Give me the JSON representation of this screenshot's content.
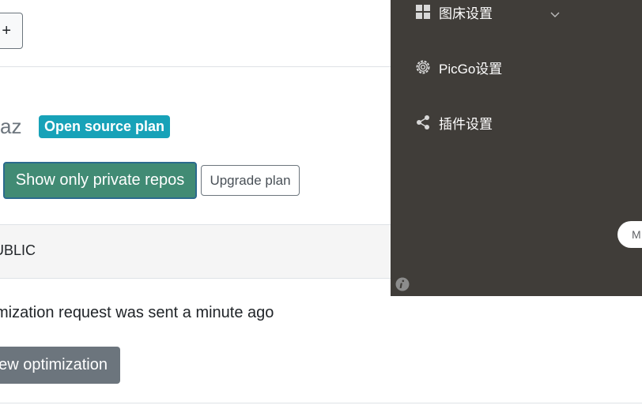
{
  "header": {
    "add_label": "+"
  },
  "profile": {
    "username_fragment": "az",
    "plan_badge": "Open source plan",
    "show_private_label": "Show only private repos",
    "upgrade_label": "Upgrade plan"
  },
  "repo": {
    "visibility_label": "UBLIC",
    "status_text": "mization request was sent a minute ago",
    "view_button_label": "ew optimization"
  },
  "picgo_panel": {
    "menu": [
      {
        "label": "图床设置",
        "icon": "grid-icon",
        "has_submenu": true
      },
      {
        "label": "PicGo设置",
        "icon": "gear-icon",
        "has_submenu": false
      },
      {
        "label": "插件设置",
        "icon": "share-icon",
        "has_submenu": false
      }
    ],
    "pill_button_label": "M",
    "info_icon": "info-icon"
  },
  "colors": {
    "panel_bg": "#403d39",
    "primary_green": "#418b74",
    "badge_teal": "#17a2b8",
    "secondary_gray": "#6c757d"
  }
}
